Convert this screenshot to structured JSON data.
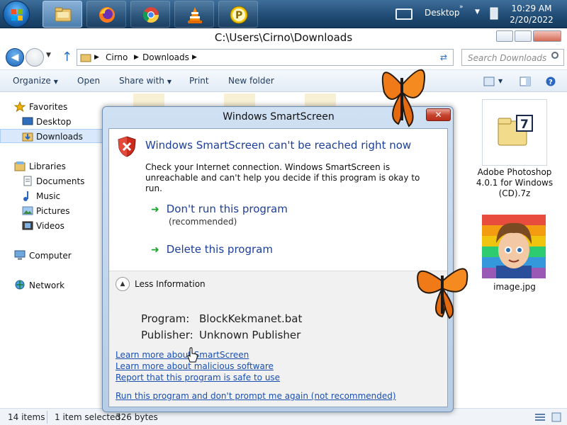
{
  "taskbar": {
    "apps": [
      "Windows Explorer",
      "Firefox",
      "Chrome",
      "VLC",
      "Media player"
    ],
    "desktop_label": "Desktop",
    "clock_time": "10:29 AM",
    "clock_date": "2/20/2022"
  },
  "explorer": {
    "title": "C:\\Users\\Cirno\\Downloads",
    "breadcrumb": [
      "Cirno",
      "Downloads"
    ],
    "search_placeholder": "Search Downloads",
    "toolbar": {
      "organize": "Organize",
      "open": "Open",
      "share_with": "Share with",
      "print": "Print",
      "new_folder": "New folder"
    },
    "nav": {
      "favorites": "Favorites",
      "desktop": "Desktop",
      "downloads": "Downloads",
      "libraries": "Libraries",
      "documents": "Documents",
      "music": "Music",
      "pictures": "Pictures",
      "videos": "Videos",
      "computer": "Computer",
      "network": "Network"
    },
    "files": [
      {
        "name": "Adobe Photoshop 4.0.1 for Windows (CD).7z"
      },
      {
        "name": "image.jpg"
      }
    ],
    "status": {
      "items": "14 items",
      "selected": "1 item selected",
      "size": "326 bytes"
    }
  },
  "dialog": {
    "title": "Windows SmartScreen",
    "heading": "Windows SmartScreen can't be reached right now",
    "description": "Check your Internet connection. Windows SmartScreen is unreachable and can't help you decide if this program is okay to run.",
    "option_dont_run": "Don't run this program",
    "option_dont_run_sub": "(recommended)",
    "option_delete": "Delete this program",
    "less_info": "Less Information",
    "program_label": "Program:",
    "program_value": "BlockKekmanet.bat",
    "publisher_label": "Publisher:",
    "publisher_value": "Unknown Publisher",
    "links": {
      "learn_smartscreen": "Learn more about SmartScreen",
      "learn_malicious": "Learn more about malicious software",
      "report_safe": "Report that this program is safe to use",
      "run_anyway": "Run this program and don't prompt me again (not recommended)"
    }
  },
  "colors": {
    "dialog_heading": "#1c3f9b",
    "link": "#1a4fb0",
    "option_arrow": "#1fa32c",
    "close_button": "#c5422c"
  }
}
